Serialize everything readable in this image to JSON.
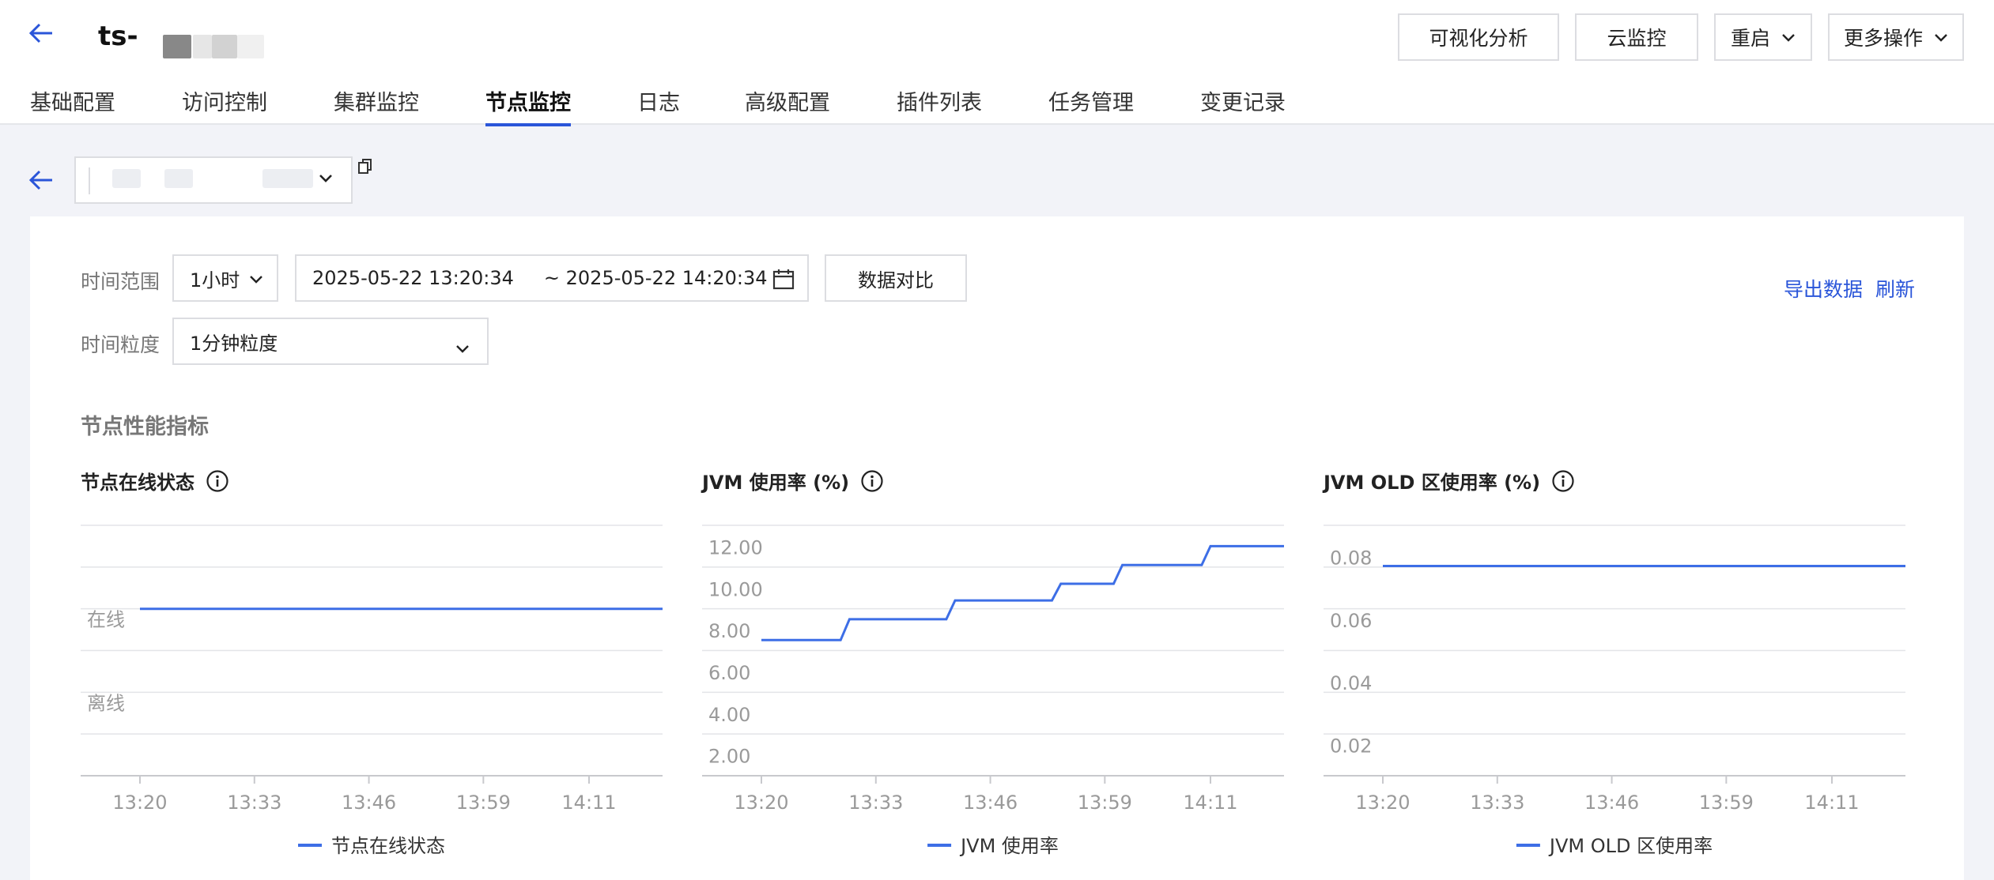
{
  "header": {
    "title": "ts-",
    "buttons": {
      "visual_analysis": "可视化分析",
      "cloud_monitor": "云监控",
      "restart": "重启",
      "more_actions": "更多操作"
    }
  },
  "tabs": [
    {
      "label": "基础配置",
      "active": false
    },
    {
      "label": "访问控制",
      "active": false
    },
    {
      "label": "集群监控",
      "active": false
    },
    {
      "label": "节点监控",
      "active": true
    },
    {
      "label": "日志",
      "active": false
    },
    {
      "label": "高级配置",
      "active": false
    },
    {
      "label": "插件列表",
      "active": false
    },
    {
      "label": "任务管理",
      "active": false
    },
    {
      "label": "变更记录",
      "active": false
    }
  ],
  "filters": {
    "time_range_label": "时间范围",
    "range_value": "1小时",
    "start_time": "2025-05-22 13:20:34",
    "end_time": "~ 2025-05-22 14:20:34",
    "compare_button": "数据对比",
    "granularity_label": "时间粒度",
    "granularity_value": "1分钟粒度",
    "export_link": "导出数据",
    "refresh_link": "刷新"
  },
  "section_title": "节点性能指标",
  "colors": {
    "accent": "#2a55d9",
    "series": "#3d6ee6"
  },
  "chart_data": [
    {
      "type": "line",
      "title": "节点在线状态",
      "x_ticks": [
        "13:20",
        "13:33",
        "13:46",
        "13:59",
        "14:11"
      ],
      "y_categories": [
        "在线",
        "离线"
      ],
      "series": [
        {
          "name": "节点在线状态",
          "x": [
            "13:20",
            "14:20"
          ],
          "values": [
            "在线",
            "在线"
          ]
        }
      ],
      "grid": true,
      "legend": "bottom"
    },
    {
      "type": "line",
      "title": "JVM 使用率 (%)",
      "x_ticks": [
        "13:20",
        "13:33",
        "13:46",
        "13:59",
        "14:11"
      ],
      "y_ticks": [
        "12.00",
        "10.00",
        "8.00",
        "6.00",
        "4.00",
        "2.00"
      ],
      "ylim": [
        0,
        14
      ],
      "series": [
        {
          "name": "JVM 使用率",
          "x": [
            "13:20",
            "13:29",
            "13:30",
            "13:41",
            "13:42",
            "13:53",
            "13:54",
            "14:00",
            "14:01",
            "14:10",
            "14:11",
            "14:20"
          ],
          "values": [
            7.5,
            7.5,
            8.5,
            8.5,
            9.4,
            9.4,
            10.2,
            10.2,
            11.1,
            11.1,
            12.0,
            12.0
          ]
        }
      ],
      "grid": true,
      "legend": "bottom"
    },
    {
      "type": "line",
      "title": "JVM OLD 区使用率 (%)",
      "x_ticks": [
        "13:20",
        "13:33",
        "13:46",
        "13:59",
        "14:11"
      ],
      "y_ticks": [
        "0.08",
        "0.06",
        "0.04",
        "0.02"
      ],
      "ylim": [
        0,
        0.08
      ],
      "series": [
        {
          "name": "JVM OLD 区使用率",
          "x": [
            "13:20",
            "14:20"
          ],
          "values": [
            0.077,
            0.077
          ]
        }
      ],
      "grid": true,
      "legend": "bottom"
    }
  ]
}
